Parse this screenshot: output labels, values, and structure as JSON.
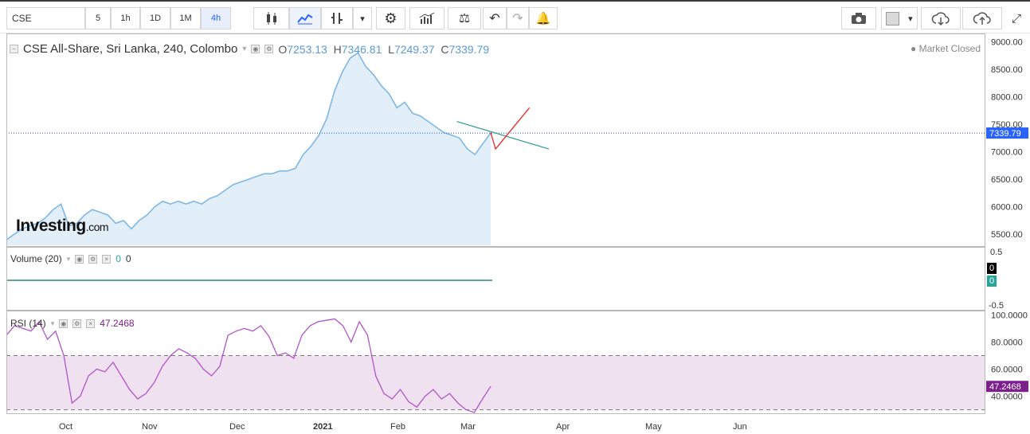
{
  "toolbar": {
    "symbol": "CSE",
    "timeframes": [
      "5",
      "1h",
      "1D",
      "1M",
      "4h"
    ],
    "active_timeframe": "4h",
    "icons": [
      "candles-icon",
      "area-chart-icon",
      "indicators-icon",
      "dropdown-icon",
      "settings-icon",
      "bar-indicators-icon",
      "compare-icon",
      "undo-icon",
      "redo-icon",
      "alert-icon",
      "camera-icon",
      "color-swatch-icon",
      "cloud-download-icon",
      "cloud-upload-icon",
      "fullscreen-icon"
    ]
  },
  "legend": {
    "title": "CSE All-Share, Sri Lanka, 240, Colombo",
    "o_label": "O",
    "o": "7253.13",
    "h_label": "H",
    "h": "7346.81",
    "l_label": "L",
    "l": "7249.37",
    "c_label": "C",
    "c": "7339.79",
    "status": "Market Closed",
    "watermark_main": "Investing",
    "watermark_suffix": ".com"
  },
  "volume": {
    "label": "Volume (20)",
    "v1": "0",
    "v2": "0",
    "badge_a": "0",
    "badge_b": "0",
    "axis": [
      "0.5",
      "-0.5"
    ]
  },
  "rsi": {
    "label": "RSI (14)",
    "value": "47.2468",
    "badge": "47.2468"
  },
  "colors": {
    "area_line": "#7fb7e6",
    "area_fill": "#e2eff9",
    "rsi_line": "#b055c6",
    "rsi_band": "#efe1f0",
    "price_line": "#2a52c9",
    "trend_green": "#2b9b8e",
    "trend_red": "#e33333",
    "volume_line": "#5aa99a"
  },
  "chart_data": [
    {
      "type": "area",
      "title": "CSE All-Share, Sri Lanka, 240, Colombo",
      "x_labels": [
        "Oct",
        "Nov",
        "Dec",
        "2021",
        "Feb",
        "Mar",
        "Apr",
        "May",
        "Jun"
      ],
      "y_ticks": [
        "9000.00",
        "8500.00",
        "8000.00",
        "7500.00",
        "7000.00",
        "6500.00",
        "6000.00",
        "5500.00"
      ],
      "ylim": [
        5300,
        9150
      ],
      "last_value": "7339.79",
      "series": [
        {
          "values": [
            5400,
            5500,
            5600,
            5650,
            5700,
            5800,
            5950,
            6050,
            5650,
            5700,
            5850,
            5950,
            5900,
            5850,
            5700,
            5750,
            5600,
            5750,
            5850,
            6000,
            6100,
            6050,
            6100,
            6050,
            6100,
            6050,
            6150,
            6200,
            6300,
            6400,
            6450,
            6500,
            6550,
            6600,
            6600,
            6650,
            6650,
            6700,
            6950,
            7100,
            7300,
            7600,
            8100,
            8450,
            8700,
            8800,
            8550,
            8400,
            8200,
            8050,
            7800,
            7900,
            7700,
            7650,
            7550,
            7450,
            7350,
            7300,
            7250,
            7050,
            6950,
            7150,
            7339.79
          ]
        }
      ],
      "trendlines": [
        {
          "color": "green",
          "from": [
            0.93,
            7550
          ],
          "to": [
            1.12,
            7050
          ]
        },
        {
          "color": "red",
          "points": [
            [
              1.0,
              7350
            ],
            [
              1.01,
              7050
            ],
            [
              1.08,
              7800
            ]
          ]
        }
      ]
    },
    {
      "type": "line",
      "title": "RSI (14)",
      "y_ticks": [
        "100.0000",
        "80.0000",
        "60.0000",
        "40.0000"
      ],
      "ylim": [
        28,
        102
      ],
      "bands": [
        70,
        30
      ],
      "last_value": "47.2468",
      "series": [
        {
          "values": [
            85,
            92,
            90,
            88,
            95,
            82,
            88,
            70,
            35,
            40,
            55,
            60,
            58,
            65,
            55,
            45,
            38,
            42,
            50,
            62,
            70,
            75,
            72,
            68,
            60,
            55,
            62,
            85,
            88,
            90,
            88,
            92,
            84,
            70,
            72,
            68,
            85,
            92,
            95,
            96,
            97,
            92,
            80,
            95,
            85,
            55,
            42,
            38,
            45,
            36,
            32,
            40,
            45,
            38,
            42,
            35,
            30,
            28,
            38,
            47.2468
          ]
        }
      ]
    }
  ]
}
